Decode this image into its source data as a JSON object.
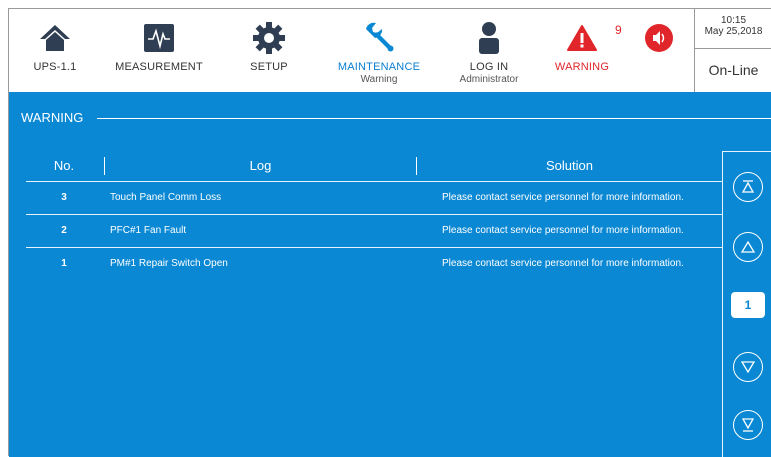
{
  "nav": {
    "ups": {
      "label": "UPS-1.1",
      "icon": "home-icon"
    },
    "measurement": {
      "label": "MEASUREMENT",
      "icon": "waveform-icon"
    },
    "setup": {
      "label": "SETUP",
      "icon": "gear-icon"
    },
    "maintenance": {
      "label": "MAINTENANCE",
      "sub": "Warning",
      "icon": "wrench-icon"
    },
    "login": {
      "label": "LOG IN",
      "sub": "Administrator",
      "icon": "user-icon"
    },
    "warning": {
      "label": "WARNING",
      "count": "9",
      "icon": "warning-triangle-icon"
    },
    "sound": {
      "icon": "speaker-icon"
    }
  },
  "clock": {
    "time": "10:15",
    "date": "May 25,2018"
  },
  "status": "On-Line",
  "section_title": "WARNING",
  "table": {
    "headers": {
      "no": "No.",
      "log": "Log",
      "solution": "Solution"
    },
    "rows": [
      {
        "no": "3",
        "log": "Touch Panel Comm Loss",
        "solution": "Please contact service personnel for more information."
      },
      {
        "no": "2",
        "log": "PFC#1 Fan Fault",
        "solution": "Please contact service personnel for more information."
      },
      {
        "no": "1",
        "log": "PM#1 Repair Switch Open",
        "solution": "Please contact service personnel for more information."
      }
    ]
  },
  "pager": {
    "page": "1"
  },
  "colors": {
    "accent": "#0a88d4",
    "warning": "#e0262a",
    "active_tab": "#0a7fd0"
  }
}
